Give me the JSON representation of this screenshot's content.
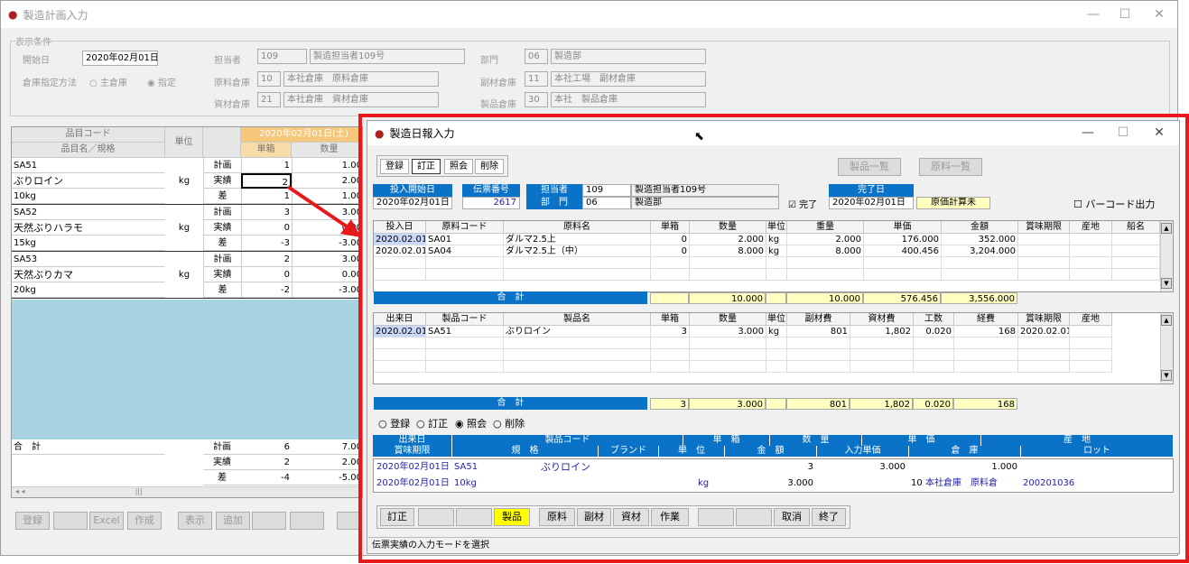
{
  "bg": {
    "title": "製造計画入力",
    "section_label": "表示条件",
    "start_label": "開始日",
    "start_value": "2020年02月01日",
    "tantou_label": "担当者",
    "tantou_code": "109",
    "tantou_name": "製造担当者109号",
    "bumon_label": "部門",
    "bumon_code": "06",
    "bumon_name": "製造部",
    "souko_label": "倉庫指定方法",
    "radio1": "主倉庫",
    "radio2": "指定",
    "genzai_label": "原料倉庫",
    "genzai_code": "10",
    "genzai_name": "本社倉庫　原料倉庫",
    "fukuzai_label": "副材倉庫",
    "fukuzai_code": "11",
    "fukuzai_name": "本社工場　副材倉庫",
    "shizai_label": "資材倉庫",
    "shizai_code": "21",
    "shizai_name": "本社倉庫　資材倉庫",
    "seihin_label": "製品倉庫",
    "seihin_code": "30",
    "seihin_name": "本社　製品倉庫",
    "grid_h1": "品目コード",
    "grid_h2": "品目名／規格",
    "grid_unit": "単位",
    "grid_date": "2020年02月01日(土)",
    "grid_box": "単箱",
    "grid_qty": "数量",
    "items": [
      {
        "code": "SA51",
        "name": "ぶりロイン",
        "spec": "10kg",
        "unit": "kg",
        "rows": [
          {
            "k": "計画",
            "b": "1",
            "q": "1.00"
          },
          {
            "k": "実績",
            "b": "2",
            "q": "2.00"
          },
          {
            "k": "差",
            "b": "1",
            "q": "1.00"
          }
        ]
      },
      {
        "code": "SA52",
        "name": "天然ぶりハラモ",
        "spec": "15kg",
        "unit": "kg",
        "rows": [
          {
            "k": "計画",
            "b": "3",
            "q": "3.00"
          },
          {
            "k": "実績",
            "b": "0",
            "q": "0.00"
          },
          {
            "k": "差",
            "b": "-3",
            "q": "-3.00"
          }
        ]
      },
      {
        "code": "SA53",
        "name": "天然ぶりカマ",
        "spec": "20kg",
        "unit": "kg",
        "rows": [
          {
            "k": "計画",
            "b": "2",
            "q": "3.00"
          },
          {
            "k": "実績",
            "b": "0",
            "q": "0.00"
          },
          {
            "k": "差",
            "b": "-2",
            "q": "-3.00"
          }
        ]
      }
    ],
    "total_label": "合　計",
    "totals": [
      {
        "k": "計画",
        "b": "6",
        "q": "7.00"
      },
      {
        "k": "実績",
        "b": "2",
        "q": "2.00"
      },
      {
        "k": "差",
        "b": "-4",
        "q": "-5.00"
      }
    ],
    "buttons": [
      "登録",
      "",
      "Excel",
      "作成",
      "表示",
      "追加",
      "",
      ""
    ]
  },
  "fg": {
    "title": "製造日報入力",
    "tb": [
      "登録",
      "訂正",
      "照会",
      "削除"
    ],
    "btn_products": "製品一覧",
    "btn_materials": "原料一覧",
    "h_start": "投入開始日",
    "v_start": "2020年02月01日",
    "h_slip": "伝票番号",
    "v_slip": "2617",
    "h_tantou": "担当者",
    "v_tantou_code": "109",
    "v_tantou_name": "製造担当者109号",
    "h_bumon": "部　門",
    "v_bumon_code": "06",
    "v_bumon_name": "製造部",
    "chk_done": "完了",
    "h_done": "完了日",
    "v_done": "2020年02月01日",
    "cost_status": "原価計算未",
    "chk_barcode": "バーコード出力",
    "t1_head": [
      "投入日",
      "原料コード",
      "原料名",
      "単箱",
      "数量",
      "単位",
      "重量",
      "単価",
      "金額",
      "賞味期限",
      "産地",
      "船名"
    ],
    "t1_rows": [
      [
        "2020.02.01",
        "SA01",
        "ダルマ2.5上",
        "0",
        "2.000",
        "kg",
        "2.000",
        "176.000",
        "352.000",
        "",
        "",
        ""
      ],
      [
        "2020.02.01",
        "SA04",
        "ダルマ2.5上（中）",
        "0",
        "8.000",
        "kg",
        "8.000",
        "400.456",
        "3,204.000",
        "",
        "",
        ""
      ]
    ],
    "t1_total_label": "合　計",
    "t1_totals": [
      "",
      "10.000",
      "",
      "10.000",
      "576.456",
      "3,556.000"
    ],
    "t2_head": [
      "出来日",
      "製品コード",
      "製品名",
      "単箱",
      "数量",
      "単位",
      "副材費",
      "資材費",
      "工数",
      "経費",
      "賞味期限",
      "産地"
    ],
    "t2_rows": [
      [
        "2020.02.01",
        "SA51",
        "ぶりロイン",
        "3",
        "3.000",
        "kg",
        "801",
        "1,802",
        "0.020",
        "168",
        "2020.02.01",
        ""
      ]
    ],
    "t2_total_label": "合　計",
    "t2_totals": [
      "3",
      "3.000",
      "",
      "801",
      "1,802",
      "0.020",
      "168"
    ],
    "modes": [
      "登録",
      "訂正",
      "照会",
      "削除"
    ],
    "d_h1": [
      "出来日",
      "製品コード",
      "単　箱",
      "数　量",
      "単　価",
      "産　地"
    ],
    "d_h2": [
      "賞味期限",
      "規　格",
      "ブランド",
      "単　位",
      "金　額",
      "入力単価",
      "倉　庫",
      "ロット"
    ],
    "d_r1": {
      "date": "2020年02月01日",
      "code": "SA51",
      "name": "ぶりロイン",
      "box": "3",
      "qty": "3.000",
      "price": "1.000"
    },
    "d_r2": {
      "date": "2020年02月01日",
      "spec": "10kg",
      "unit": "kg",
      "amount": "3.000",
      "wh_code": "10",
      "wh_name": "本社倉庫　原料倉",
      "lot": "200201036"
    },
    "fbtns": [
      "訂正",
      "",
      "",
      "製品",
      "原料",
      "副材",
      "資材",
      "作業",
      "",
      "",
      "取消",
      "終了"
    ],
    "status": "伝票実績の入力モードを選択"
  },
  "colors": {
    "highlight": "#e8191b",
    "header_blue": "#0a73c8",
    "yellow": "#ffff00",
    "grid_bg": "#a8d3e0"
  }
}
